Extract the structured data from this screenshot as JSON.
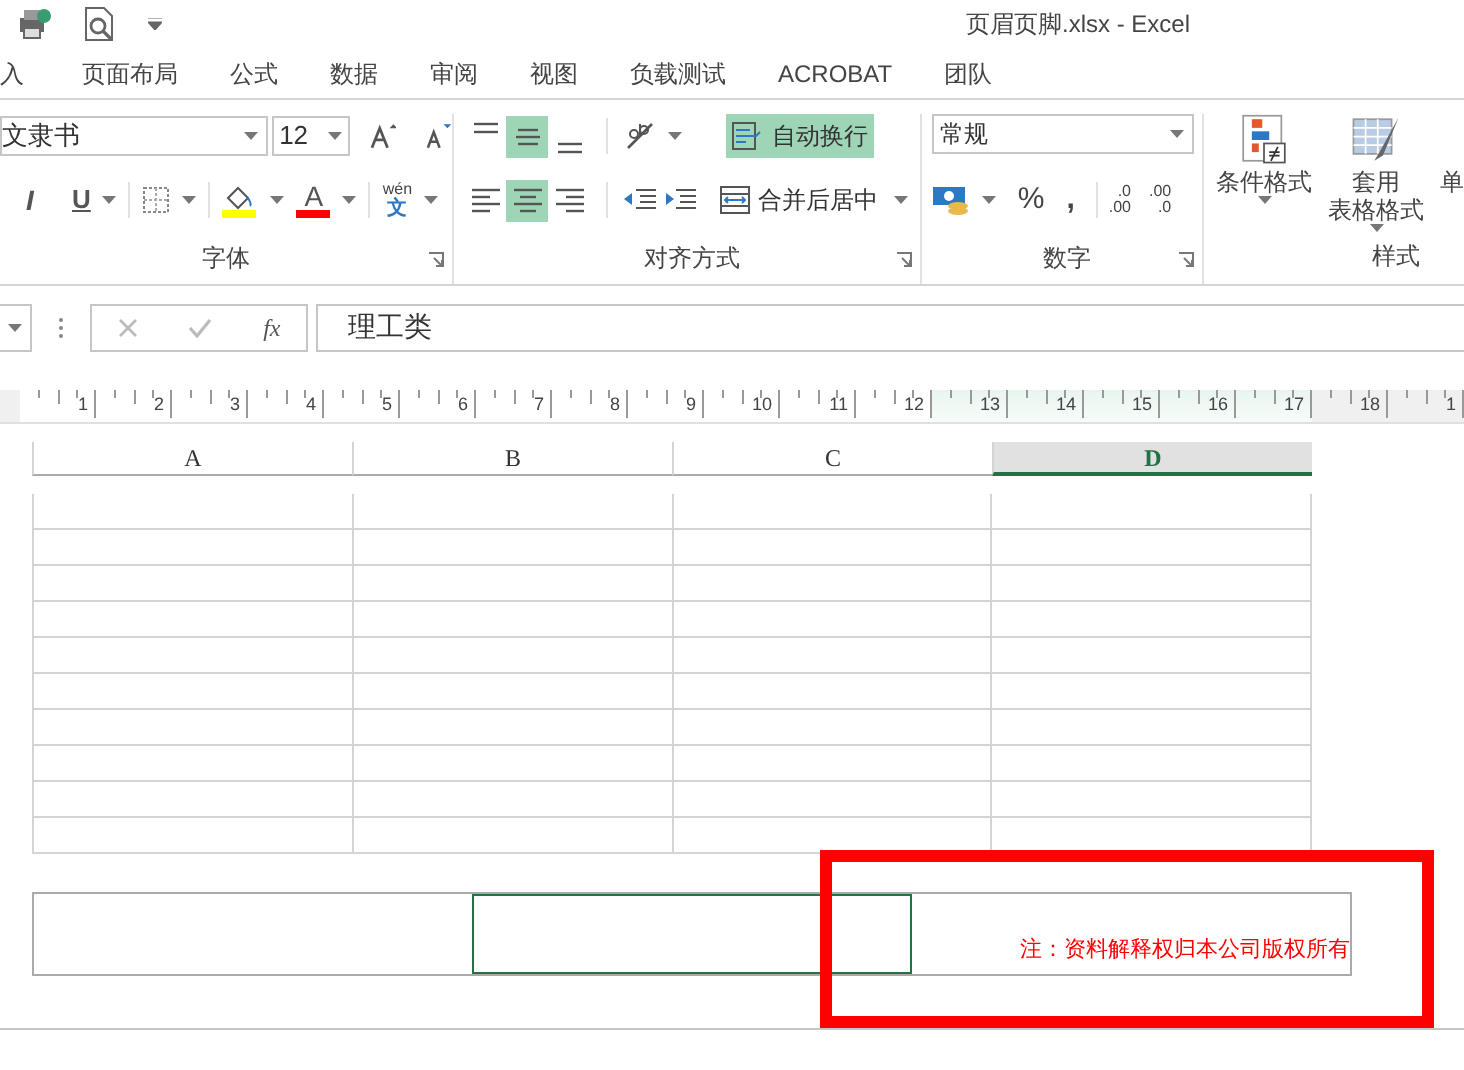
{
  "title_bar": {
    "title": "页眉页脚.xlsx - Excel"
  },
  "ribbon_tabs": [
    {
      "label": "入",
      "selected": false
    },
    {
      "label": "页面布局",
      "selected": false
    },
    {
      "label": "公式",
      "selected": false
    },
    {
      "label": "数据",
      "selected": false
    },
    {
      "label": "审阅",
      "selected": false
    },
    {
      "label": "视图",
      "selected": false
    },
    {
      "label": "负载测试",
      "selected": false
    },
    {
      "label": "ACROBAT",
      "selected": false
    },
    {
      "label": "团队",
      "selected": false
    }
  ],
  "font_group": {
    "label": "字体",
    "font_name": "文隶书",
    "font_size": "12",
    "italic": "I",
    "underline": "U",
    "font_color_letter": "A",
    "phonetic_top": "wén",
    "phonetic_bottom": "文"
  },
  "alignment_group": {
    "label": "对齐方式",
    "vertical": [
      {
        "kind": "top",
        "selected": false
      },
      {
        "kind": "middle",
        "selected": true
      },
      {
        "kind": "bottom",
        "selected": false
      }
    ],
    "horizontal": [
      {
        "kind": "left",
        "selected": false
      },
      {
        "kind": "center",
        "selected": true
      },
      {
        "kind": "right",
        "selected": false
      }
    ],
    "wrap_text": {
      "label": "自动换行",
      "selected": true
    },
    "merge_center": {
      "label": "合并后居中"
    }
  },
  "number_group": {
    "label": "数字",
    "format": "常规",
    "percent": "%",
    "comma": ",",
    "increase_decimal": [
      ".0",
      ".00"
    ],
    "decrease_decimal": [
      ".00",
      ".0"
    ]
  },
  "styles_group": {
    "label": "样式",
    "buttons": [
      {
        "lines": [
          "条件格式"
        ],
        "kind": "conditional"
      },
      {
        "lines": [
          "套用",
          "表格格式"
        ],
        "kind": "table"
      },
      {
        "lines": [
          "单"
        ],
        "kind": "cut"
      }
    ]
  },
  "formula_bar": {
    "fx": "fx",
    "content": "理工类"
  },
  "ruler": {
    "ticks": [
      {
        "label": "1",
        "selected": false
      },
      {
        "label": "2",
        "selected": false
      },
      {
        "label": "3",
        "selected": false
      },
      {
        "label": "4",
        "selected": false
      },
      {
        "label": "5",
        "selected": false
      },
      {
        "label": "6",
        "selected": false
      },
      {
        "label": "7",
        "selected": false
      },
      {
        "label": "8",
        "selected": false
      },
      {
        "label": "9",
        "selected": false
      },
      {
        "label": "10",
        "selected": false
      },
      {
        "label": "11",
        "selected": false
      },
      {
        "label": "12",
        "selected": false
      },
      {
        "label": "13",
        "selected": true
      },
      {
        "label": "14",
        "selected": true
      },
      {
        "label": "15",
        "selected": true
      },
      {
        "label": "16",
        "selected": true
      },
      {
        "label": "17",
        "selected": true
      },
      {
        "label": "18",
        "selected": false
      },
      {
        "label": "1",
        "selected": false
      }
    ]
  },
  "columns": [
    {
      "label": "A",
      "selected": false
    },
    {
      "label": "B",
      "selected": false
    },
    {
      "label": "C",
      "selected": false
    },
    {
      "label": "D",
      "selected": true
    }
  ],
  "footer": {
    "sections": [
      {
        "selected": false
      },
      {
        "selected": true
      },
      {
        "selected": false,
        "text": "注：资料解释权归本公司版权所有"
      }
    ]
  }
}
